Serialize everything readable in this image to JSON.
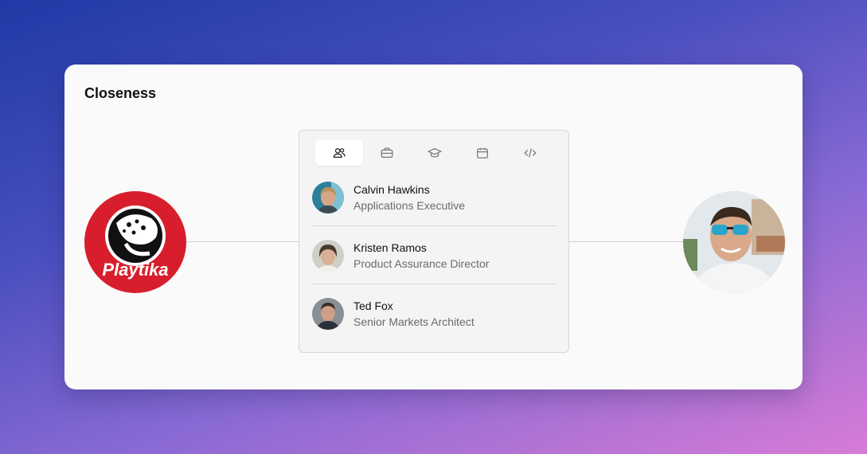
{
  "card": {
    "title": "Closeness"
  },
  "company": {
    "logo_text": "Playtika",
    "logo_color": "#d81e2c"
  },
  "tabs": [
    {
      "icon": "people-icon",
      "active": true
    },
    {
      "icon": "briefcase-icon",
      "active": false
    },
    {
      "icon": "graduation-cap-icon",
      "active": false
    },
    {
      "icon": "calendar-icon",
      "active": false
    },
    {
      "icon": "code-icon",
      "active": false
    }
  ],
  "connections": [
    {
      "name": "Calvin Hawkins",
      "role": "Applications Executive"
    },
    {
      "name": "Kristen Ramos",
      "role": "Product Assurance Director"
    },
    {
      "name": "Ted Fox",
      "role": "Senior Markets Architect"
    }
  ]
}
